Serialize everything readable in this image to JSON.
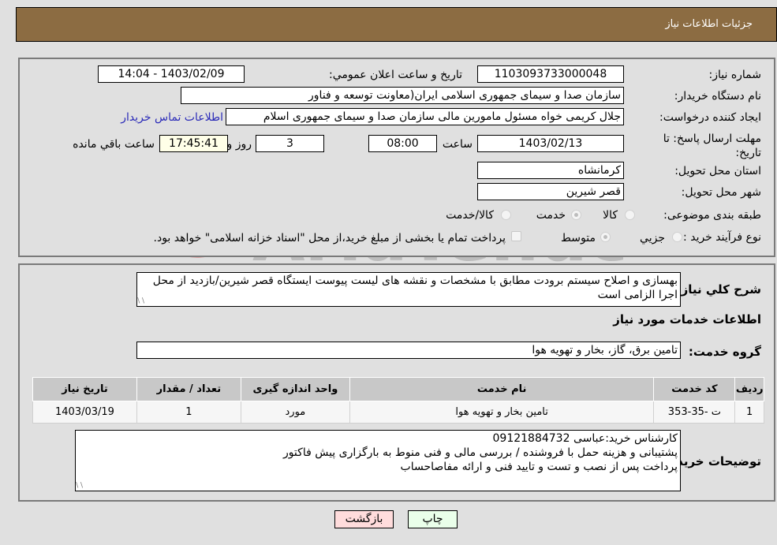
{
  "header": {
    "title": "جزئيات اطلاعات نياز"
  },
  "fields": {
    "need_number": {
      "label": "شماره نیاز:",
      "value": "1103093733000048"
    },
    "announce_datetime": {
      "label": "تاریخ و ساعت اعلان عمومي:",
      "value": "1403/02/09 - 14:04"
    },
    "buyer_org": {
      "label": "نام دستگاه خریدار:",
      "value": "سازمان صدا و سیمای جمهوری اسلامی ایران(معاونت توسعه و فناور"
    },
    "requester": {
      "label": "ایجاد کننده درخواست:",
      "value": "جلال کریمی خواه مسئول مامورین مالی  سازمان صدا و سیمای جمهوری اسلام",
      "contact_link": "اطلاعات تماس خریدار"
    },
    "deadline": {
      "label": "مهلت ارسال پاسخ: تا تاریخ:",
      "date": "1403/02/13",
      "time_label": "ساعت",
      "time": "08:00",
      "days": "3",
      "days_label": "روز و",
      "remaining": "17:45:41",
      "remaining_label": "ساعت باقي مانده"
    },
    "province": {
      "label": "استان محل تحویل:",
      "value": "کرمانشاه"
    },
    "city": {
      "label": "شهر محل تحویل:",
      "value": "قصر شیرین"
    },
    "category": {
      "label": "طبقه بندی موضوعی:",
      "options": [
        "کالا",
        "خدمت",
        "کالا/خدمت"
      ],
      "selected": "خدمت"
    },
    "purchase_type": {
      "label": "نوع فرآیند خرید :",
      "options": [
        "جزيي",
        "متوسط"
      ],
      "selected": "متوسط",
      "treasury_note": "پرداخت تمام یا بخشی از مبلغ خرید،از محل \"اسناد خزانه اسلامی\" خواهد بود."
    }
  },
  "description": {
    "label": "شرح كلي نياز:",
    "text": "بهسازی و اصلاح سیستم برودت مطابق با مشخصات و نقشه های لیست پیوست ایستگاه قصر شیرین/بازدید از محل اجرا الزامی است"
  },
  "services": {
    "section_title": "اطلاعات خدمات مورد نياز",
    "group_label": "گروه خدمت:",
    "group_value": "تامین برق، گاز، بخار و تهویه هوا",
    "table": {
      "headers": [
        "رديف",
        "کد خدمت",
        "نام خدمت",
        "واحد اندازه گیری",
        "تعداد / مقدار",
        "تاریخ نیاز"
      ],
      "rows": [
        [
          "1",
          "ت -35-353",
          "تامین بخار و تهویه هوا",
          "مورد",
          "1",
          "1403/03/19"
        ]
      ]
    }
  },
  "buyer_notes": {
    "label": "توضیحات خریدار:",
    "lines": [
      "کارشناس خرید:عباسی 09121884732",
      "پشتیبانی و هزینه حمل با فروشنده / بررسی مالی و فنی منوط به بارگزاری پیش فاکتور",
      "پرداخت پس از نصب و تست و تایید فنی و ارائه مفاصاحساب"
    ]
  },
  "buttons": {
    "print": "چاپ",
    "back": "بازگشت"
  },
  "watermark": {
    "text": "AriaTender.neT"
  }
}
